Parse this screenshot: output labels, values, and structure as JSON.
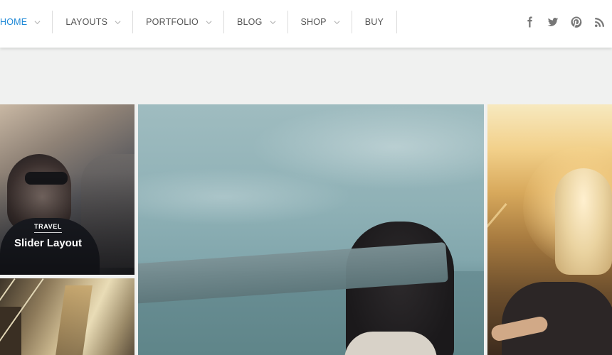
{
  "nav": {
    "items": [
      {
        "label": "HOME",
        "active": true,
        "has_dropdown": true
      },
      {
        "label": "LAYOUTS",
        "active": false,
        "has_dropdown": true
      },
      {
        "label": "PORTFOLIO",
        "active": false,
        "has_dropdown": true
      },
      {
        "label": "BLOG",
        "active": false,
        "has_dropdown": true
      },
      {
        "label": "SHOP",
        "active": false,
        "has_dropdown": true
      },
      {
        "label": "BUY",
        "active": false,
        "has_dropdown": false
      }
    ],
    "active_color": "#1e88d6",
    "text_color": "#555555"
  },
  "social": {
    "icons": [
      "facebook-icon",
      "twitter-icon",
      "pinterest-icon",
      "rss-icon"
    ]
  },
  "featured": {
    "posts": [
      {
        "category": "TRAVEL",
        "title": "Slider Layout"
      }
    ]
  },
  "colors": {
    "page_background": "#f0f1f0",
    "header_background": "#ffffff"
  }
}
